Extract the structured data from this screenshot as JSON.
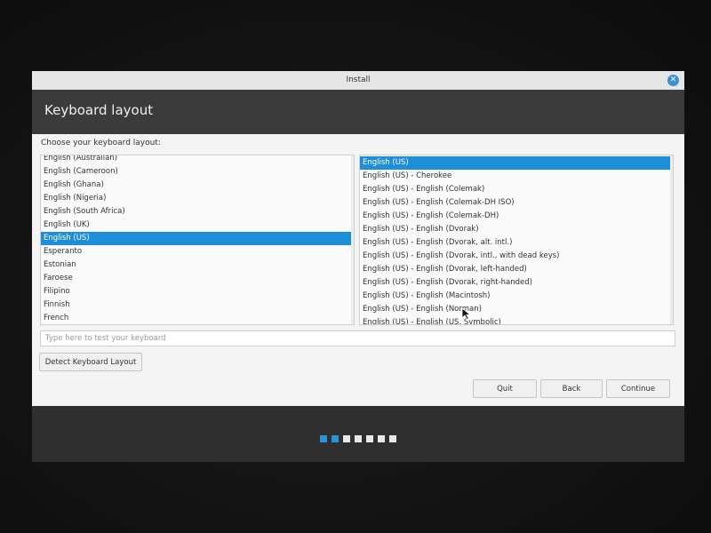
{
  "window": {
    "title": "Install",
    "close_glyph": "✕"
  },
  "header": {
    "title": "Keyboard layout"
  },
  "layout_label": "Choose your keyboard layout:",
  "layouts": [
    {
      "label": "English (Australian)",
      "selected": false
    },
    {
      "label": "English (Cameroon)",
      "selected": false
    },
    {
      "label": "English (Ghana)",
      "selected": false
    },
    {
      "label": "English (Nigeria)",
      "selected": false
    },
    {
      "label": "English (South Africa)",
      "selected": false
    },
    {
      "label": "English (UK)",
      "selected": false
    },
    {
      "label": "English (US)",
      "selected": true
    },
    {
      "label": "Esperanto",
      "selected": false
    },
    {
      "label": "Estonian",
      "selected": false
    },
    {
      "label": "Faroese",
      "selected": false
    },
    {
      "label": "Filipino",
      "selected": false
    },
    {
      "label": "Finnish",
      "selected": false
    },
    {
      "label": "French",
      "selected": false
    }
  ],
  "variants": [
    {
      "label": "English (US)",
      "selected": true
    },
    {
      "label": "English (US) - Cherokee",
      "selected": false
    },
    {
      "label": "English (US) - English (Colemak)",
      "selected": false
    },
    {
      "label": "English (US) - English (Colemak-DH ISO)",
      "selected": false
    },
    {
      "label": "English (US) - English (Colemak-DH)",
      "selected": false
    },
    {
      "label": "English (US) - English (Dvorak)",
      "selected": false
    },
    {
      "label": "English (US) - English (Dvorak, alt. intl.)",
      "selected": false
    },
    {
      "label": "English (US) - English (Dvorak, intl., with dead keys)",
      "selected": false
    },
    {
      "label": "English (US) - English (Dvorak, left-handed)",
      "selected": false
    },
    {
      "label": "English (US) - English (Dvorak, right-handed)",
      "selected": false
    },
    {
      "label": "English (US) - English (Macintosh)",
      "selected": false
    },
    {
      "label": "English (US) - English (Norman)",
      "selected": false
    },
    {
      "label": "English (US) - English (US, Symbolic)",
      "selected": false
    }
  ],
  "test_input": {
    "placeholder": "Type here to test your keyboard",
    "value": ""
  },
  "buttons": {
    "detect": "Detect Keyboard Layout",
    "quit": "Quit",
    "back": "Back",
    "continue": "Continue"
  },
  "progress": {
    "total_steps": 7,
    "current_step": 2
  },
  "colors": {
    "accent": "#1f8ed9",
    "header_bg": "#3b3b3b",
    "footer_bg": "#2f2f2f"
  }
}
